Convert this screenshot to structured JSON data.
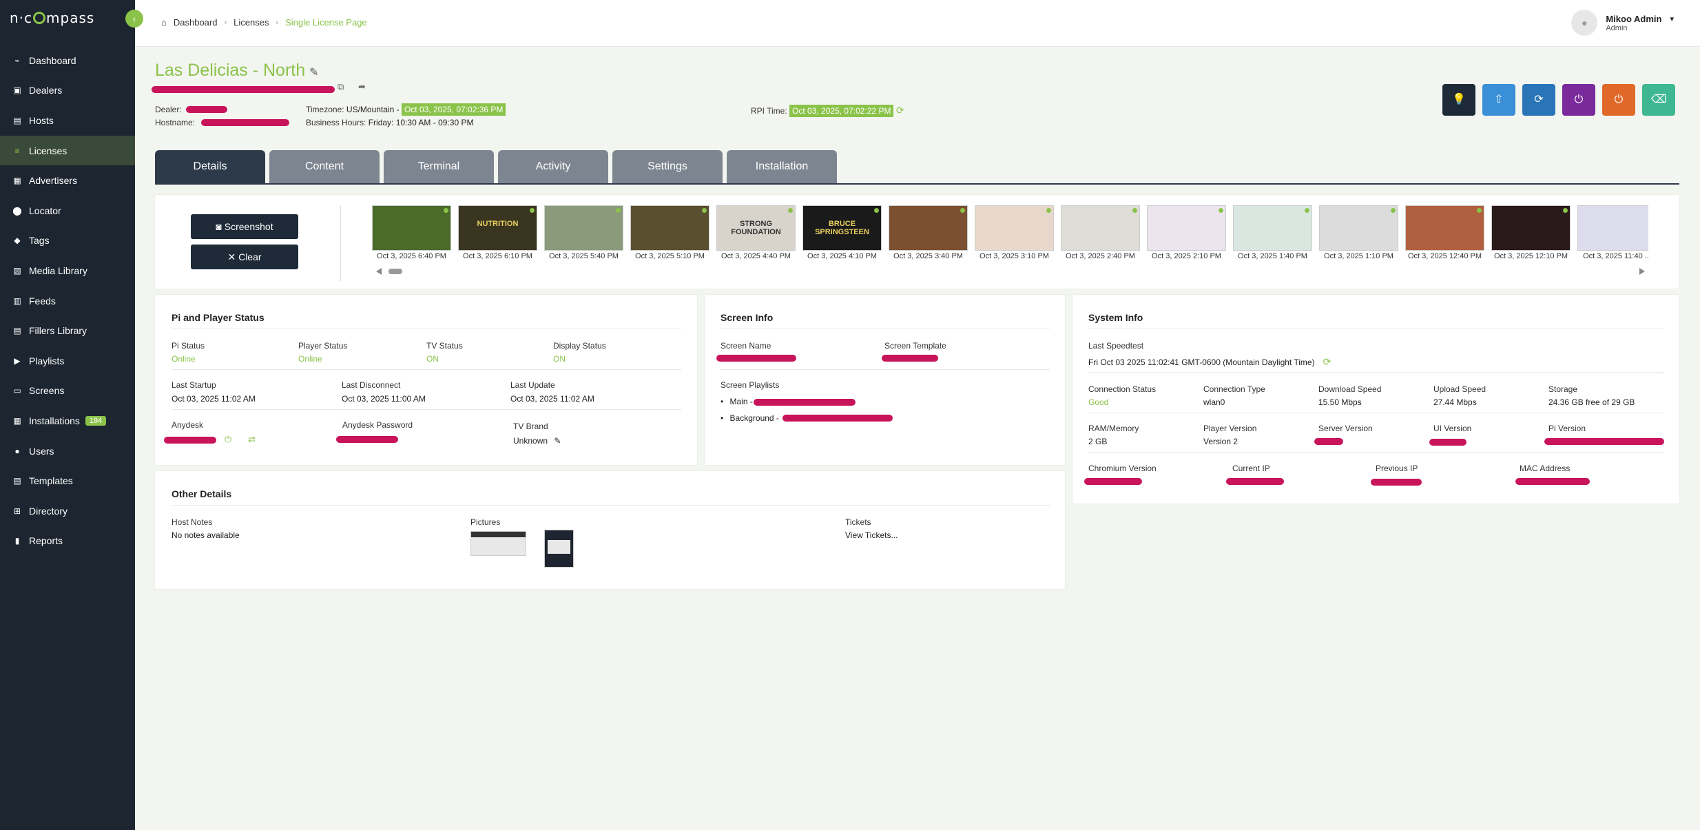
{
  "brand": {
    "logo": "n-compass",
    "accent": "#8bc34a",
    "sidebar_bg": "#1c2530"
  },
  "sidebar": {
    "items": [
      {
        "label": "Dashboard",
        "icon": "chart-line-icon"
      },
      {
        "label": "Dealers",
        "icon": "briefcase-icon"
      },
      {
        "label": "Hosts",
        "icon": "map-icon"
      },
      {
        "label": "Licenses",
        "icon": "list-icon",
        "active": true
      },
      {
        "label": "Advertisers",
        "icon": "ad-icon"
      },
      {
        "label": "Locator",
        "icon": "map-pin-icon"
      },
      {
        "label": "Tags",
        "icon": "tags-icon"
      },
      {
        "label": "Media Library",
        "icon": "photo-icon"
      },
      {
        "label": "Feeds",
        "icon": "feed-icon"
      },
      {
        "label": "Fillers Library",
        "icon": "library-icon"
      },
      {
        "label": "Playlists",
        "icon": "play-icon"
      },
      {
        "label": "Screens",
        "icon": "monitor-icon"
      },
      {
        "label": "Installations",
        "icon": "calendar-icon",
        "badge": "194"
      },
      {
        "label": "Users",
        "icon": "users-icon"
      },
      {
        "label": "Templates",
        "icon": "template-icon"
      },
      {
        "label": "Directory",
        "icon": "sitemap-icon"
      },
      {
        "label": "Reports",
        "icon": "chart-bar-icon"
      }
    ]
  },
  "breadcrumb": {
    "home": "Dashboard",
    "parent": "Licenses",
    "current": "Single License Page"
  },
  "user": {
    "name": "Mikoo Admin",
    "role": "Admin"
  },
  "license": {
    "title": "Las Delicias - North",
    "dealer_label": "Dealer:",
    "hostname_label": "Hostname:",
    "timezone_label": "Timezone:",
    "timezone_value": "US/Mountain -",
    "timezone_time": "Oct 03, 2025, 07:02:36 PM",
    "hours_label": "Business Hours:",
    "hours_value": "Friday: 10:30 AM - 09:30 PM",
    "rpi_label": "RPI Time:",
    "rpi_time": "Oct 03, 2025, 07:02:22 PM"
  },
  "actions": [
    {
      "icon": "lightbulb-icon",
      "color": "#1e2a38"
    },
    {
      "icon": "upload-icon",
      "color": "#3a8fd6"
    },
    {
      "icon": "sync-icon",
      "color": "#2a74b8"
    },
    {
      "icon": "power-icon",
      "color": "#7b2a9b"
    },
    {
      "icon": "power-off-icon",
      "color": "#e0692a"
    },
    {
      "icon": "eraser-icon",
      "color": "#3fb892"
    }
  ],
  "tabs": [
    "Details",
    "Content",
    "Terminal",
    "Activity",
    "Settings",
    "Installation"
  ],
  "screenshot": {
    "screenshot_label": "Screenshot",
    "clear_label": "Clear",
    "thumbs": [
      {
        "cap": "Oct 3, 2025 6:40 PM",
        "color": "#4a6b2a",
        "text": ""
      },
      {
        "cap": "Oct 3, 2025 6:10 PM",
        "color": "#3a3520",
        "text": "NUTRITION"
      },
      {
        "cap": "Oct 3, 2025 5:40 PM",
        "color": "#8a9a7a",
        "text": ""
      },
      {
        "cap": "Oct 3, 2025 5:10 PM",
        "color": "#5a5030",
        "text": ""
      },
      {
        "cap": "Oct 3, 2025 4:40 PM",
        "color": "#d8d4cc",
        "text": "STRONG FOUNDATION"
      },
      {
        "cap": "Oct 3, 2025 4:10 PM",
        "color": "#1a1a1a",
        "text": "BRUCE SPRINGSTEEN"
      },
      {
        "cap": "Oct 3, 2025 3:40 PM",
        "color": "#7a5030",
        "text": ""
      },
      {
        "cap": "Oct 3, 2025 3:10 PM",
        "color": "#e8d8cc",
        "text": ""
      },
      {
        "cap": "Oct 3, 2025 2:40 PM",
        "color": "#e0dcd8",
        "text": ""
      },
      {
        "cap": "Oct 3, 2025 2:10 PM",
        "color": "#ece4ee",
        "text": ""
      },
      {
        "cap": "Oct 3, 2025 1:40 PM",
        "color": "#d8e8e0",
        "text": ""
      },
      {
        "cap": "Oct 3, 2025 1:10 PM",
        "color": "#dcdcdc",
        "text": ""
      },
      {
        "cap": "Oct 3, 2025 12:40 PM",
        "color": "#b06040",
        "text": ""
      },
      {
        "cap": "Oct 3, 2025 12:10 PM",
        "color": "#2a1a1a",
        "text": ""
      },
      {
        "cap": "Oct 3, 2025 11:40 ...",
        "color": "#dcdcec",
        "text": ""
      }
    ]
  },
  "pi_status": {
    "title": "Pi and Player Status",
    "pi_status_label": "Pi Status",
    "pi_status": "Online",
    "player_status_label": "Player Status",
    "player_status": "Online",
    "tv_status_label": "TV Status",
    "tv_status": "ON",
    "display_status_label": "Display Status",
    "display_status": "ON",
    "last_startup_label": "Last Startup",
    "last_startup": "Oct 03, 2025 11:02 AM",
    "last_disconnect_label": "Last Disconnect",
    "last_disconnect": "Oct 03, 2025 11:00 AM",
    "last_update_label": "Last Update",
    "last_update": "Oct 03, 2025 11:02 AM",
    "anydesk_label": "Anydesk",
    "anydesk_password_label": "Anydesk Password",
    "tv_brand_label": "TV Brand",
    "tv_brand": "Unknown"
  },
  "screen_info": {
    "title": "Screen Info",
    "screen_name_label": "Screen Name",
    "screen_template_label": "Screen Template",
    "playlists_label": "Screen Playlists",
    "main_label": "Main -",
    "background_label": "Background -"
  },
  "system_info": {
    "title": "System Info",
    "speedtest_label": "Last Speedtest",
    "speedtest_value": "Fri Oct 03 2025 11:02:41 GMT-0600 (Mountain Daylight Time)",
    "conn_status_label": "Connection Status",
    "conn_status": "Good",
    "conn_type_label": "Connection Type",
    "conn_type": "wlan0",
    "download_label": "Download Speed",
    "download": "15.50 Mbps",
    "upload_label": "Upload Speed",
    "upload": "27.44 Mbps",
    "storage_label": "Storage",
    "storage": "24.36 GB free of 29 GB",
    "ram_label": "RAM/Memory",
    "ram": "2 GB",
    "player_version_label": "Player Version",
    "player_version": "Version 2",
    "server_version_label": "Server Version",
    "ui_version_label": "UI Version",
    "pi_version_label": "Pi Version",
    "chromium_label": "Chromium Version",
    "current_ip_label": "Current IP",
    "previous_ip_label": "Previous IP",
    "mac_label": "MAC Address"
  },
  "other_details": {
    "title": "Other Details",
    "host_notes_label": "Host Notes",
    "host_notes": "No notes available",
    "pictures_label": "Pictures",
    "tickets_label": "Tickets",
    "tickets_link": "View Tickets..."
  }
}
